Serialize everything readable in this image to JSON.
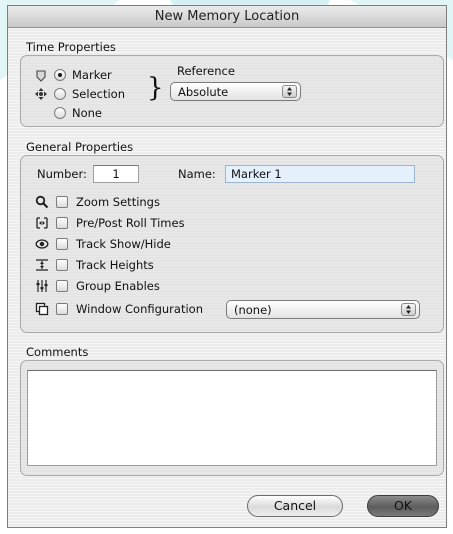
{
  "window": {
    "title": "New Memory Location"
  },
  "time_properties": {
    "label": "Time Properties",
    "options": [
      {
        "label": "Marker",
        "selected": true,
        "icon": "marker-icon"
      },
      {
        "label": "Selection",
        "selected": false,
        "icon": "selection-icon"
      },
      {
        "label": "None",
        "selected": false,
        "icon": ""
      }
    ],
    "reference_label": "Reference",
    "reference_value": "Absolute"
  },
  "general_properties": {
    "label": "General Properties",
    "number_label": "Number:",
    "number_value": "1",
    "name_label": "Name:",
    "name_value": "Marker 1",
    "checkboxes": [
      {
        "label": "Zoom Settings",
        "checked": false,
        "icon": "magnifier-icon"
      },
      {
        "label": "Pre/Post Roll Times",
        "checked": false,
        "icon": "pre-post-roll-icon"
      },
      {
        "label": "Track Show/Hide",
        "checked": false,
        "icon": "track-show-hide-icon"
      },
      {
        "label": "Track Heights",
        "checked": false,
        "icon": "track-heights-icon"
      },
      {
        "label": "Group Enables",
        "checked": false,
        "icon": "group-enables-icon"
      },
      {
        "label": "Window Configuration",
        "checked": false,
        "icon": "window-configuration-icon"
      }
    ],
    "window_config_value": "(none)"
  },
  "comments": {
    "label": "Comments",
    "value": ""
  },
  "buttons": {
    "cancel": "Cancel",
    "ok": "OK"
  },
  "colors": {
    "background_decor": "#cfeff2",
    "window": "#ececec"
  }
}
